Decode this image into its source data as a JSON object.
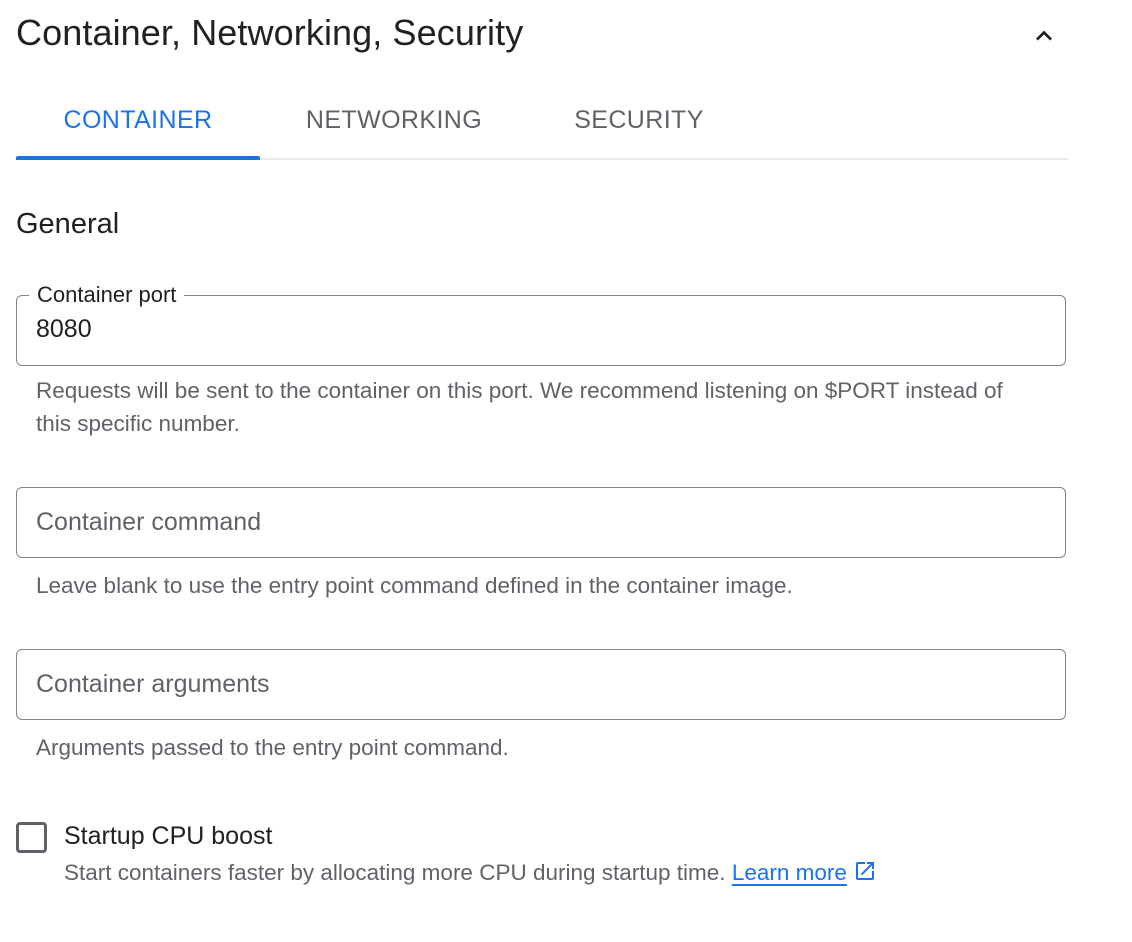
{
  "section": {
    "title": "Container, Networking, Security",
    "collapse_icon": "chevron-up-icon"
  },
  "tabs": [
    {
      "label": "CONTAINER",
      "active": true
    },
    {
      "label": "NETWORKING",
      "active": false
    },
    {
      "label": "SECURITY",
      "active": false
    }
  ],
  "general": {
    "title": "General",
    "container_port": {
      "label": "Container port",
      "value": "8080",
      "helper": "Requests will be sent to the container on this port. We recommend listening on $PORT instead of this specific number."
    },
    "container_command": {
      "placeholder": "Container command",
      "value": "",
      "helper": "Leave blank to use the entry point command defined in the container image."
    },
    "container_arguments": {
      "placeholder": "Container arguments",
      "value": "",
      "helper": "Arguments passed to the entry point command."
    },
    "startup_cpu_boost": {
      "label": "Startup CPU boost",
      "checked": false,
      "description": "Start containers faster by allocating more CPU during startup time.",
      "link_text": "Learn more",
      "link_icon": "external-link-icon"
    }
  },
  "colors": {
    "accent": "#1a73e8",
    "text_primary": "#202124",
    "text_secondary": "#5f6368",
    "border": "#80868b",
    "divider": "#e8eaed"
  }
}
